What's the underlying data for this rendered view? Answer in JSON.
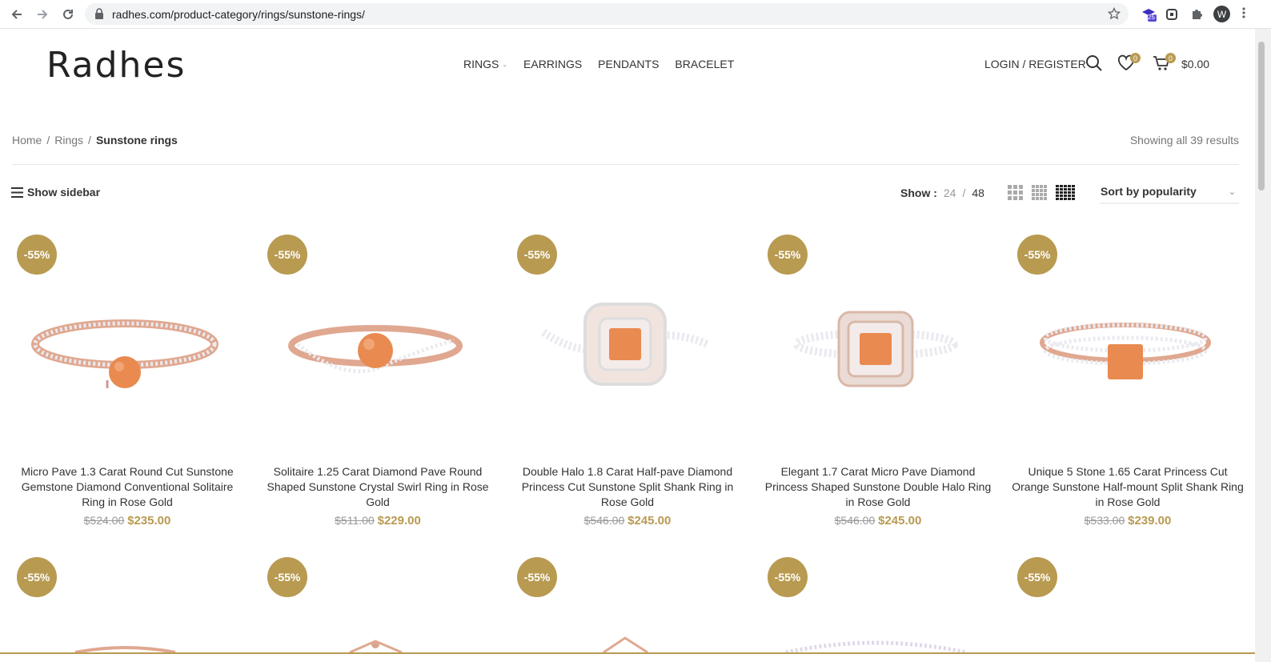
{
  "browser": {
    "url": "radhes.com/product-category/rings/sunstone-rings/",
    "ext_badge": "25",
    "profile_initial": "W"
  },
  "header": {
    "logo": "Radhes",
    "nav": [
      {
        "label": "RINGS",
        "has_dropdown": true
      },
      {
        "label": "EARRINGS"
      },
      {
        "label": "PENDANTS"
      },
      {
        "label": "BRACELET"
      }
    ],
    "login": "LOGIN / REGISTER",
    "wishlist_count": "0",
    "cart_count": "0",
    "cart_total": "$0.00"
  },
  "breadcrumb": {
    "items": [
      "Home",
      "Rings"
    ],
    "current": "Sunstone rings",
    "sep": "/"
  },
  "results_text": "Showing all 39 results",
  "toolbar": {
    "show_sidebar": "Show sidebar",
    "show_label": "Show :",
    "per_page": [
      "24",
      "48"
    ],
    "per_page_sep": "/",
    "sort": "Sort by popularity"
  },
  "colors": {
    "accent": "#b89a51"
  },
  "products": [
    {
      "badge": "-55%",
      "title": "Micro Pave 1.3 Carat Round Cut Sunstone Gemstone Diamond Conventional Solitaire Ring in Rose Gold",
      "old_price": "$524.00",
      "price": "$235.00"
    },
    {
      "badge": "-55%",
      "title": "Solitaire 1.25 Carat Diamond Pave Round Shaped Sunstone Crystal Swirl Ring in Rose Gold",
      "old_price": "$511.00",
      "price": "$229.00"
    },
    {
      "badge": "-55%",
      "title": "Double Halo 1.8 Carat Half-pave Diamond Princess Cut Sunstone Split Shank Ring in Rose Gold",
      "old_price": "$546.00",
      "price": "$245.00"
    },
    {
      "badge": "-55%",
      "title": "Elegant 1.7 Carat Micro Pave Diamond Princess Shaped Sunstone Double Halo Ring in Rose Gold",
      "old_price": "$546.00",
      "price": "$245.00"
    },
    {
      "badge": "-55%",
      "title": "Unique 5 Stone 1.65 Carat Princess Cut Orange Sunstone Half-mount Split Shank Ring in Rose Gold",
      "old_price": "$533.00",
      "price": "$239.00"
    }
  ],
  "second_row_badges": [
    "-55%",
    "-55%",
    "-55%",
    "-55%",
    "-55%"
  ]
}
